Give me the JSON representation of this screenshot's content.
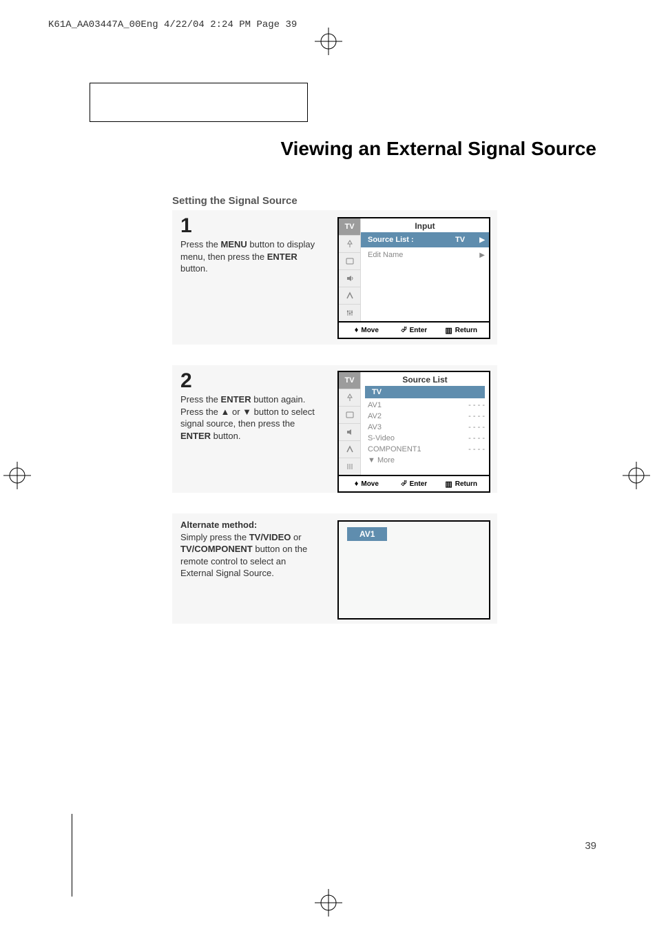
{
  "print_header": "K61A_AA03447A_00Eng  4/22/04  2:24 PM  Page 39",
  "title": "Viewing an External Signal Source",
  "subtitle": "Setting the Signal Source",
  "step1": {
    "num": "1",
    "text_a": "Press the ",
    "text_b": "MENU",
    "text_c": " button to display menu, then press the ",
    "text_d": "ENTER",
    "text_e": " button."
  },
  "step2": {
    "num": "2",
    "text_a": "Press the ",
    "text_b": "ENTER",
    "text_c": " button again. Press the ▲ or ▼ button to select signal source, then press the ",
    "text_d": "ENTER",
    "text_e": " button."
  },
  "step3": {
    "heading": "Alternate method:",
    "text_a": "Simply press the ",
    "text_b": "TV/VIDEO",
    "text_c": " or ",
    "text_d": "TV/COMPONENT",
    "text_e": " button on the remote control to select an External Signal Source."
  },
  "osd1": {
    "title": "Input",
    "side_tv": "TV",
    "rows": [
      {
        "label": "Source List :",
        "val": "TV",
        "arrow": "▶",
        "hl": true
      },
      {
        "label": "Edit Name",
        "val": "",
        "arrow": "▶",
        "hl": false
      }
    ],
    "foot": {
      "move": "Move",
      "enter": "Enter",
      "return": "Return"
    }
  },
  "osd2": {
    "title": "Source List",
    "side_tv": "TV",
    "rows": [
      {
        "label": "TV",
        "val": "",
        "hl": true
      },
      {
        "label": "AV1",
        "val": "- - - -",
        "hl": false
      },
      {
        "label": "AV2",
        "val": "- - - -",
        "hl": false
      },
      {
        "label": "AV3",
        "val": "- - - -",
        "hl": false
      },
      {
        "label": "S-Video",
        "val": "- - - -",
        "hl": false
      },
      {
        "label": "COMPONENT1",
        "val": "- - - -",
        "hl": false
      },
      {
        "label": "▼ More",
        "val": "",
        "hl": false
      }
    ],
    "foot": {
      "move": "Move",
      "enter": "Enter",
      "return": "Return"
    }
  },
  "osd3": {
    "badge": "AV1"
  },
  "page_num": "39"
}
